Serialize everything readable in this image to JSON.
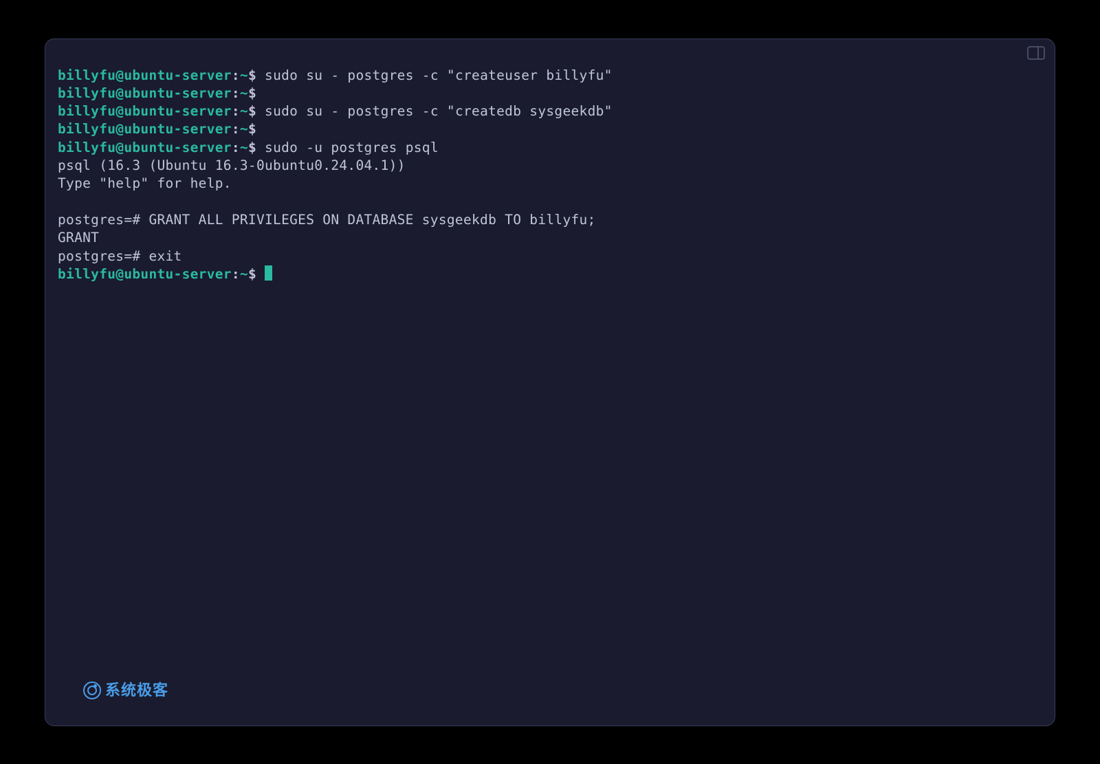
{
  "prompt": {
    "user_host": "billyfu@ubuntu-server",
    "colon": ":",
    "path": "~",
    "dollar": "$"
  },
  "lines": [
    {
      "type": "prompt",
      "cmd": " sudo su - postgres -c \"createuser billyfu\""
    },
    {
      "type": "prompt",
      "cmd": ""
    },
    {
      "type": "prompt",
      "cmd": " sudo su - postgres -c \"createdb sysgeekdb\""
    },
    {
      "type": "prompt",
      "cmd": ""
    },
    {
      "type": "prompt",
      "cmd": " sudo -u postgres psql"
    },
    {
      "type": "output",
      "text": "psql (16.3 (Ubuntu 16.3-0ubuntu0.24.04.1))"
    },
    {
      "type": "output",
      "text": "Type \"help\" for help."
    },
    {
      "type": "blank"
    },
    {
      "type": "output",
      "text": "postgres=# GRANT ALL PRIVILEGES ON DATABASE sysgeekdb TO billyfu;"
    },
    {
      "type": "output",
      "text": "GRANT"
    },
    {
      "type": "output",
      "text": "postgres=# exit"
    },
    {
      "type": "prompt_cursor",
      "cmd": " "
    }
  ],
  "watermark": {
    "text": "系统极客"
  }
}
